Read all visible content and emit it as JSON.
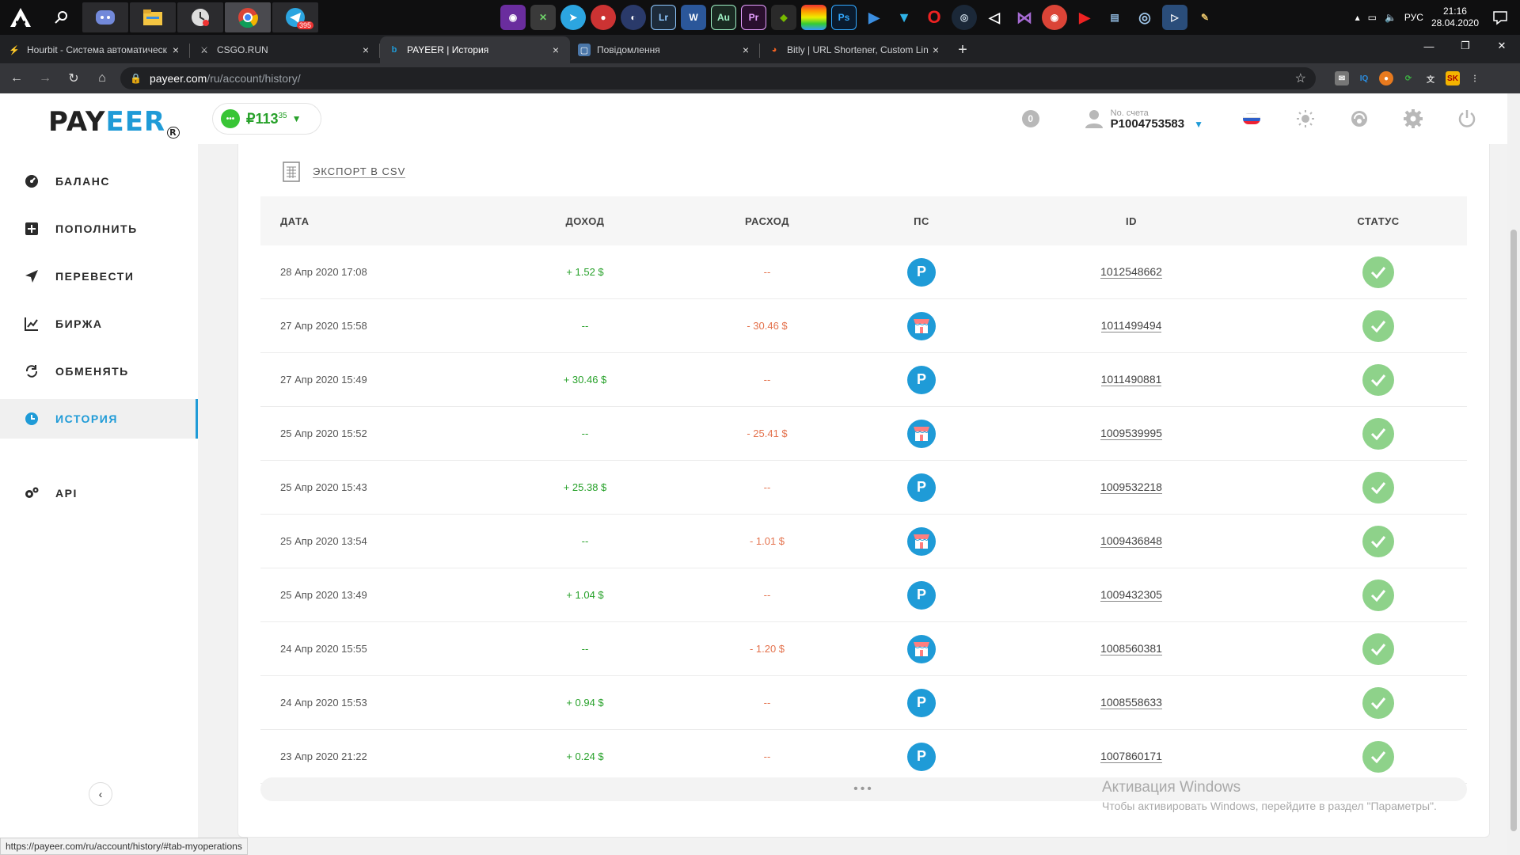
{
  "os": {
    "clock_time": "21:16",
    "clock_date": "28.04.2020",
    "lang": "РУС",
    "telegram_badge": "395"
  },
  "browser": {
    "tabs": [
      {
        "title": "Hourbit - Система автоматическ",
        "active": false
      },
      {
        "title": "CSGO.RUN",
        "active": false
      },
      {
        "title": "PAYEER | История",
        "active": true
      },
      {
        "title": "Повідомлення",
        "active": false
      },
      {
        "title": "Bitly | URL Shortener, Custom Lin",
        "active": false
      }
    ],
    "url_host": "payeer.com",
    "url_path": "/ru/account/history/",
    "status_url": "https://payeer.com/ru/account/history/#tab-myoperations"
  },
  "sidebar": {
    "logo_a": "PAY",
    "logo_b": "EER",
    "items": [
      {
        "label": "БАЛАНС",
        "icon": "gauge-icon"
      },
      {
        "label": "ПОПОЛНИТЬ",
        "icon": "plus-square-icon"
      },
      {
        "label": "ПЕРЕВЕСТИ",
        "icon": "send-icon"
      },
      {
        "label": "БИРЖА",
        "icon": "chart-icon"
      },
      {
        "label": "ОБМЕНЯТЬ",
        "icon": "exchange-icon"
      },
      {
        "label": "ИСТОРИЯ",
        "icon": "clock-icon"
      },
      {
        "label": "API",
        "icon": "gears-icon"
      }
    ]
  },
  "header": {
    "balance_main": "₽113",
    "balance_cents": "35",
    "notifications": "0",
    "account_label": "No. счета",
    "account_number": "P1004753583"
  },
  "history": {
    "export_label": "ЭКСПОРТ В CSV",
    "columns": [
      "ДАТА",
      "ДОХОД",
      "РАСХОД",
      "ПС",
      "ID",
      "СТАТУС"
    ],
    "rows": [
      {
        "date": "28 Апр 2020 17:08",
        "income": "+ 1.52 $",
        "expense": "--",
        "ps": "payeer",
        "id": "1012548662"
      },
      {
        "date": "27 Апр 2020 15:58",
        "income": "--",
        "expense": "- 30.46 $",
        "ps": "shop",
        "id": "1011499494"
      },
      {
        "date": "27 Апр 2020 15:49",
        "income": "+ 30.46 $",
        "expense": "--",
        "ps": "payeer",
        "id": "1011490881"
      },
      {
        "date": "25 Апр 2020 15:52",
        "income": "--",
        "expense": "- 25.41 $",
        "ps": "shop",
        "id": "1009539995"
      },
      {
        "date": "25 Апр 2020 15:43",
        "income": "+ 25.38 $",
        "expense": "--",
        "ps": "payeer",
        "id": "1009532218"
      },
      {
        "date": "25 Апр 2020 13:54",
        "income": "--",
        "expense": "- 1.01 $",
        "ps": "shop",
        "id": "1009436848"
      },
      {
        "date": "25 Апр 2020 13:49",
        "income": "+ 1.04 $",
        "expense": "--",
        "ps": "payeer",
        "id": "1009432305"
      },
      {
        "date": "24 Апр 2020 15:55",
        "income": "--",
        "expense": "- 1.20 $",
        "ps": "shop",
        "id": "1008560381"
      },
      {
        "date": "24 Апр 2020 15:53",
        "income": "+ 0.94 $",
        "expense": "--",
        "ps": "payeer",
        "id": "1008558633"
      },
      {
        "date": "23 Апр 2020 21:22",
        "income": "+ 0.24 $",
        "expense": "--",
        "ps": "payeer",
        "id": "1007860171"
      }
    ],
    "load_more": "•••"
  },
  "windows_activation": {
    "title": "Активация Windows",
    "subtitle": "Чтобы активировать Windows, перейдите в раздел \"Параметры\"."
  },
  "colors": {
    "accent": "#1f9bd7",
    "income": "#27a12a",
    "expense": "#e4724d",
    "status_ok": "#8ed28a"
  }
}
